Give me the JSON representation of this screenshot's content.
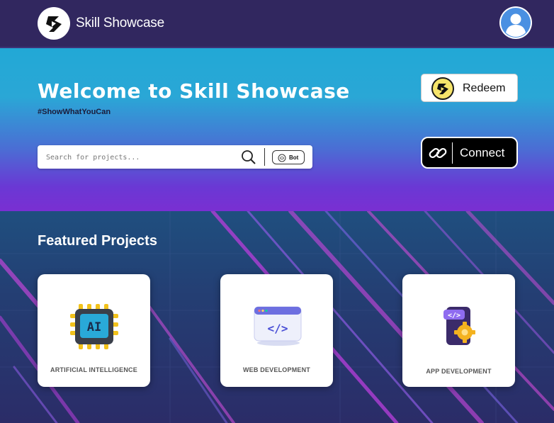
{
  "header": {
    "brand": "Skill Showcase"
  },
  "hero": {
    "title": "Welcome to Skill Showcase",
    "hashtag": "#ShowWhatYouCan",
    "search": {
      "placeholder": "Search for projects...",
      "value": ""
    },
    "bot_label": "Bot",
    "redeem_label": "Redeem",
    "connect_label": "Connect"
  },
  "featured": {
    "title": "Featured Projects",
    "cards": [
      {
        "label": "ARTIFICIAL INTELLIGENCE",
        "icon": "ai-chip-icon"
      },
      {
        "label": "WEB DEVELOPMENT",
        "icon": "web-code-icon"
      },
      {
        "label": "APP DEVELOPMENT",
        "icon": "app-gear-icon"
      }
    ]
  },
  "colors": {
    "header_bg": "#31275f",
    "hero_top": "#22a8d6",
    "hero_bottom": "#7a2fd2",
    "accent_purple": "#7a2fd2"
  }
}
